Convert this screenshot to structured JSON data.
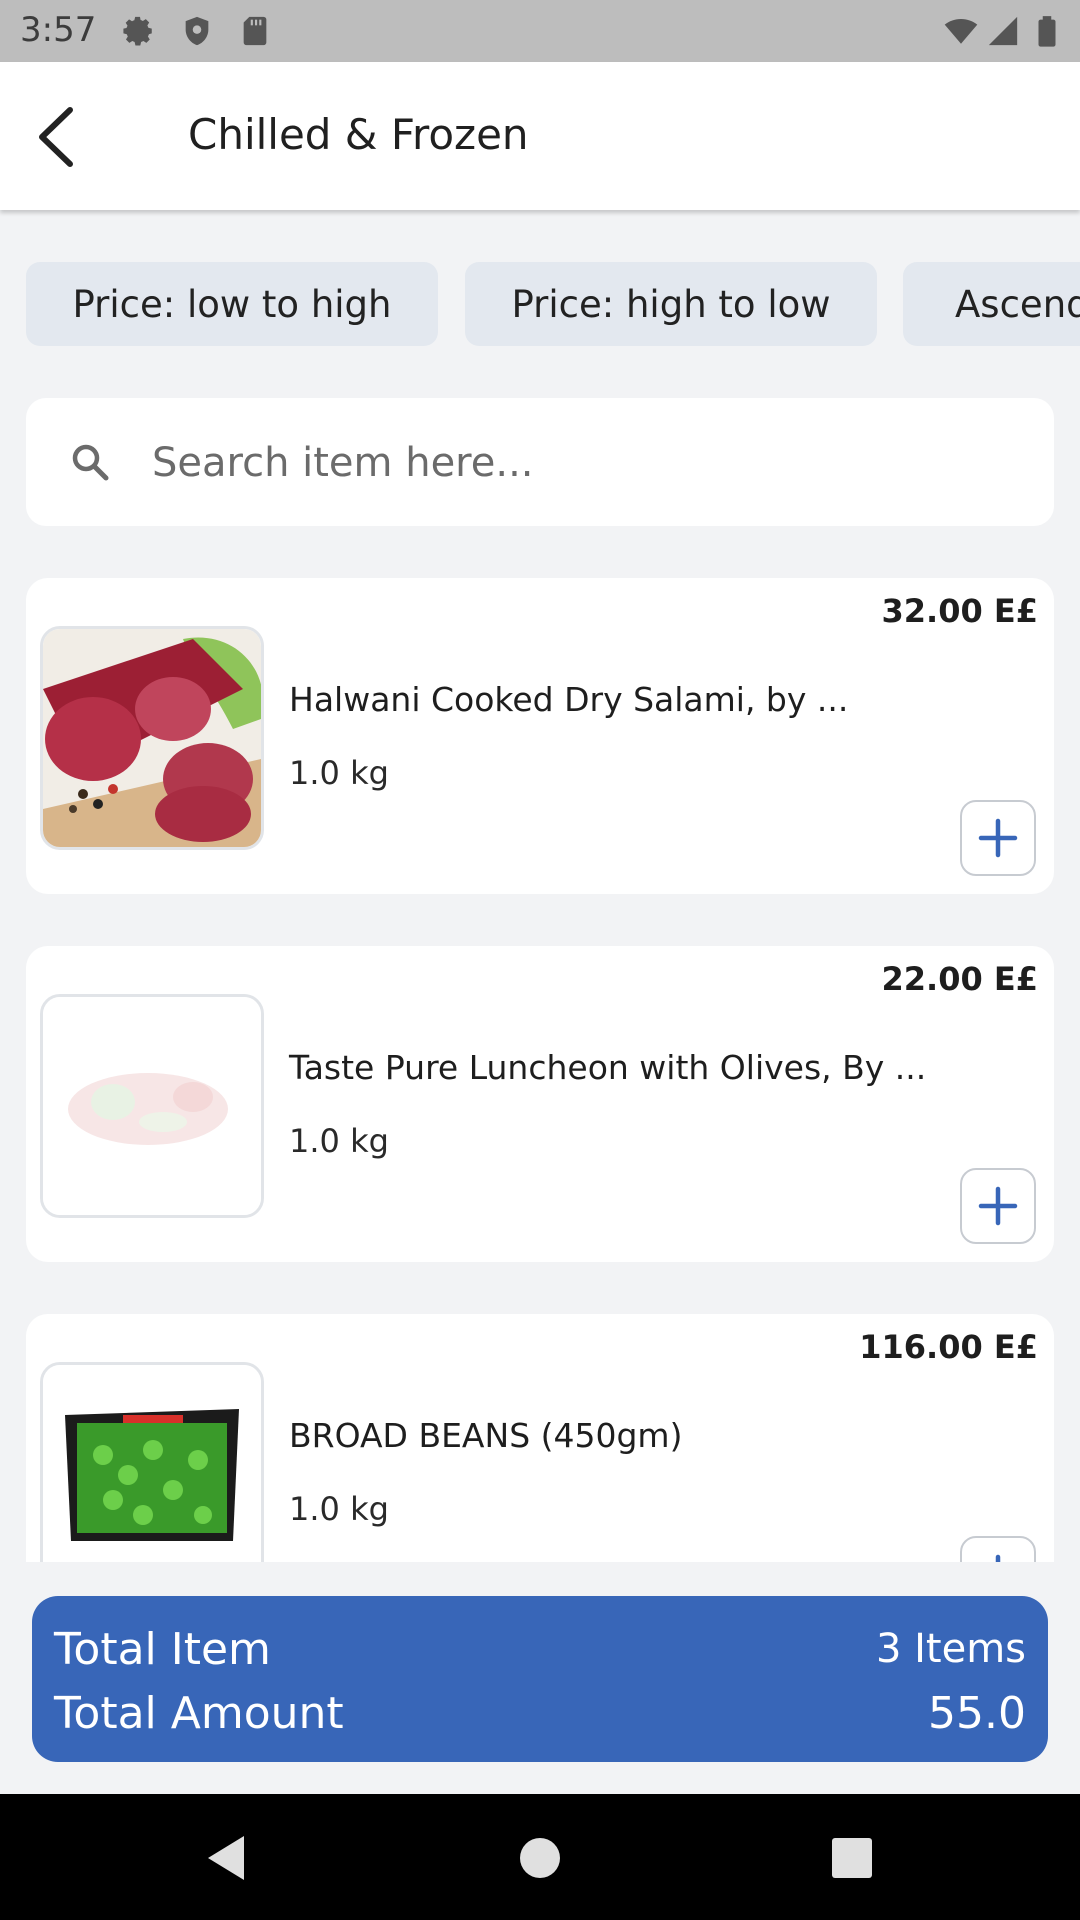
{
  "status_bar": {
    "time": "3:57",
    "left_icons": [
      "settings-icon",
      "shield-icon",
      "sd-card-icon"
    ],
    "right_icons": [
      "wifi-icon",
      "signal-icon",
      "battery-icon"
    ]
  },
  "header": {
    "title": "Chilled & Frozen"
  },
  "sort_chips": [
    "Price: low to high",
    "Price: high to low",
    "Ascending"
  ],
  "search": {
    "placeholder": "Search item here..."
  },
  "products": [
    {
      "name": "Halwani Cooked Dry Salami, by ...",
      "quantity": "1.0 kg",
      "price": "32.00 E£"
    },
    {
      "name": "Taste Pure Luncheon with Olives, By ...",
      "quantity": "1.0 kg",
      "price": "22.00 E£"
    },
    {
      "name": "BROAD BEANS (450gm)",
      "quantity": "1.0 kg",
      "price": "116.00 E£"
    }
  ],
  "totals": {
    "item_label": "Total Item",
    "item_value": "3 Items",
    "amount_label": "Total Amount",
    "amount_value": "55.0"
  },
  "colors": {
    "accent": "#3866b8",
    "chip_bg": "#e3e8ef",
    "page_bg": "#f2f3f5"
  }
}
